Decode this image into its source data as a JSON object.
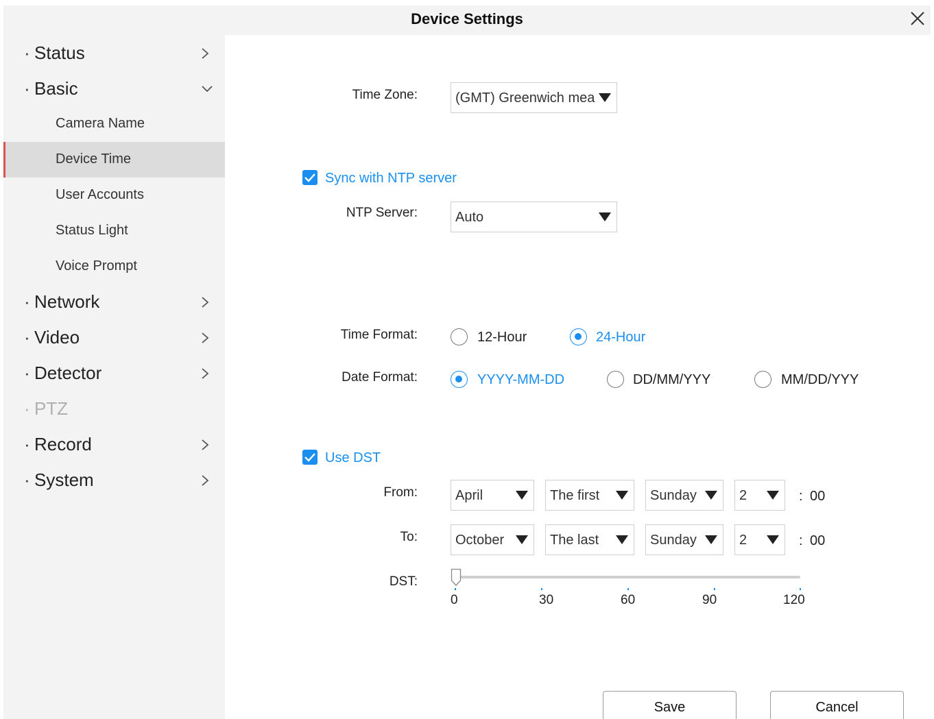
{
  "window": {
    "title": "Device Settings"
  },
  "sidebar": {
    "items": [
      {
        "label": "Status",
        "bullet": "·"
      },
      {
        "label": "Basic",
        "bullet": "·"
      },
      {
        "label": "Network",
        "bullet": "·"
      },
      {
        "label": "Video",
        "bullet": "·"
      },
      {
        "label": "Detector",
        "bullet": "·"
      },
      {
        "label": "PTZ",
        "bullet": "·"
      },
      {
        "label": "Record",
        "bullet": "·"
      },
      {
        "label": "System",
        "bullet": "·"
      }
    ],
    "basic_subitems": [
      {
        "label": "Camera Name"
      },
      {
        "label": "Device Time",
        "active": true
      },
      {
        "label": "User Accounts"
      },
      {
        "label": "Status Light"
      },
      {
        "label": "Voice Prompt"
      }
    ]
  },
  "form": {
    "time_zone": {
      "label": "Time Zone:",
      "value": "(GMT) Greenwich mea"
    },
    "sync_ntp": {
      "label": "Sync with NTP server",
      "checked": true
    },
    "ntp_server": {
      "label": "NTP Server:",
      "value": "Auto"
    },
    "time_format": {
      "label": "Time Format:",
      "options": [
        "12-Hour",
        "24-Hour"
      ],
      "selected": "24-Hour"
    },
    "date_format": {
      "label": "Date Format:",
      "options": [
        "YYYY-MM-DD",
        "DD/MM/YYY",
        "MM/DD/YYY"
      ],
      "selected": "YYYY-MM-DD"
    },
    "use_dst": {
      "label": "Use DST",
      "checked": true
    },
    "dst_from": {
      "label": "From:",
      "month": "April",
      "week": "The first",
      "day": "Sunday",
      "hour": "2",
      "colon": ":",
      "minutes": "00"
    },
    "dst_to": {
      "label": "To:",
      "month": "October",
      "week": "The last",
      "day": "Sunday",
      "hour": "2",
      "colon": ":",
      "minutes": "00"
    },
    "dst_offset": {
      "label": "DST:",
      "value": 0,
      "ticks": [
        "0",
        "30",
        "60",
        "90",
        "120"
      ]
    }
  },
  "buttons": {
    "save": "Save",
    "cancel": "Cancel"
  },
  "colors": {
    "accent": "#1a8ff0",
    "active_marker": "#d9534f",
    "sidebar_bg": "#f3f3f3"
  }
}
